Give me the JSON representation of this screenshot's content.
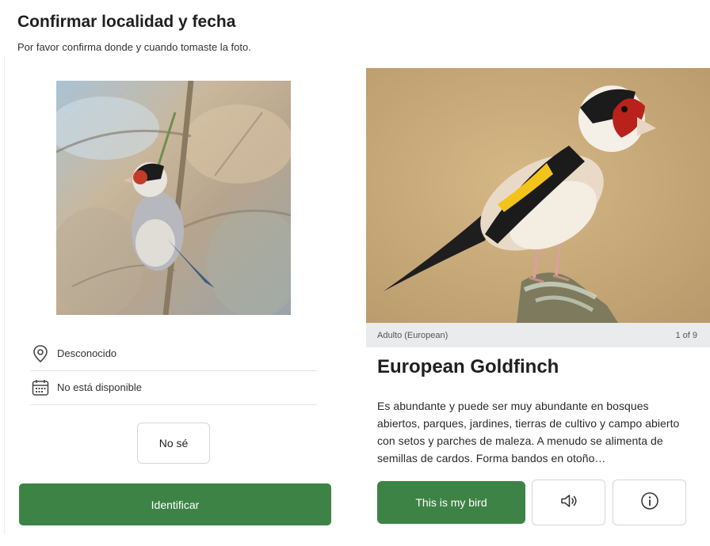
{
  "header": {
    "title": "Confirmar localidad y fecha",
    "subtitle": "Por favor confirma donde y cuando tomaste la foto."
  },
  "location": {
    "icon": "location-pin-icon",
    "value": "Desconocido"
  },
  "date": {
    "icon": "calendar-icon",
    "value": "No está disponible"
  },
  "buttons": {
    "dont_know": "No sé",
    "identify": "Identificar",
    "this_is_my_bird": "This is my bird"
  },
  "result": {
    "caption": "Adulto (European)",
    "page_counter": "1 of 9",
    "species_name": "European Goldfinch",
    "description": "Es abundante y puede ser muy abundante en bosques abiertos, parques, jardines, tierras de cultivo y campo abierto con setos y parches de maleza. A menudo se alimenta de semillas de cardos. Forma bandos en otoño…"
  },
  "colors": {
    "accent_green": "#3d8345",
    "caption_bar": "#e9ebec",
    "border": "#d6d6d6"
  }
}
